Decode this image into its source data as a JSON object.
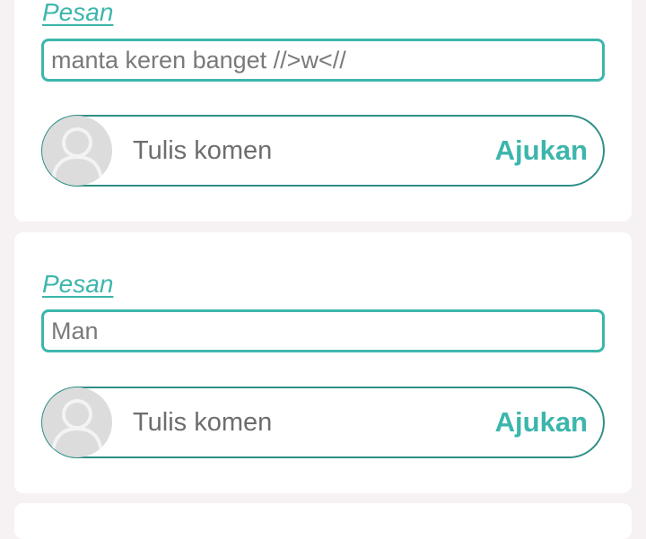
{
  "posts": [
    {
      "label": "Pesan",
      "message": "manta keren banget //>w<//",
      "comment_placeholder": "Tulis komen",
      "submit_label": "Ajukan"
    },
    {
      "label": "Pesan",
      "message": "Man",
      "comment_placeholder": "Tulis komen",
      "submit_label": "Ajukan"
    }
  ],
  "icons": {
    "avatar": "user-placeholder-icon"
  },
  "colors": {
    "accent": "#3cb6ac",
    "border_dark": "#2f8f87",
    "background": "#f6f1f3",
    "avatar_bg": "#dcdcdc"
  }
}
